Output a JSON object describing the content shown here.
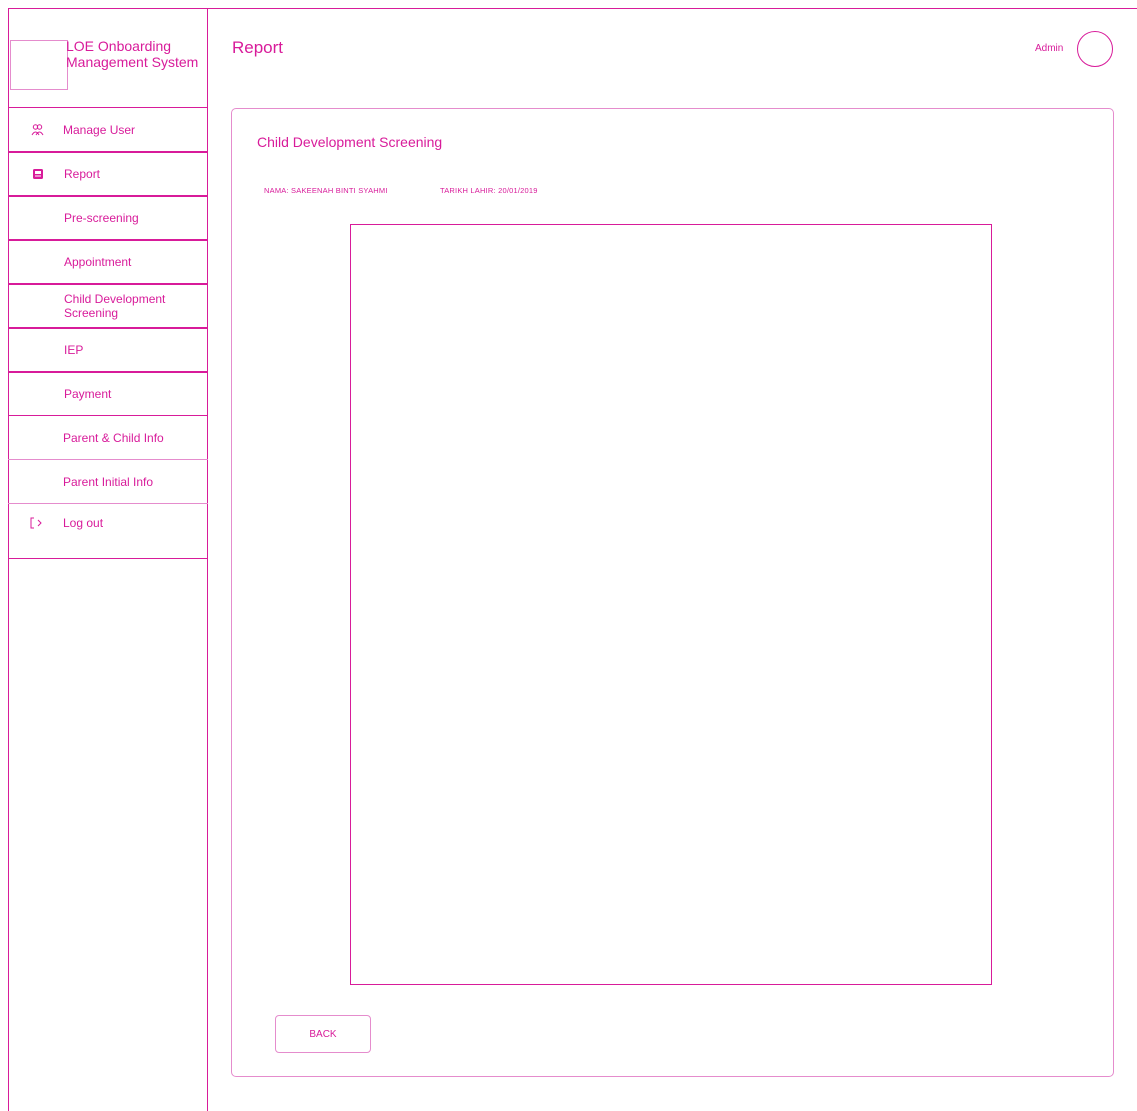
{
  "app": {
    "title": "LOE Onboarding Management System"
  },
  "header": {
    "page_title": "Report",
    "user_label": "Admin"
  },
  "sidebar": {
    "items": [
      {
        "label": "Manage User",
        "icon": "users-icon"
      },
      {
        "label": "Report",
        "icon": "report-icon"
      },
      {
        "label": "Pre-screening"
      },
      {
        "label": "Appointment"
      },
      {
        "label": "Child Development Screening"
      },
      {
        "label": "IEP"
      },
      {
        "label": "Payment"
      },
      {
        "label": "Parent & Child Info"
      },
      {
        "label": "Parent Initial Info"
      },
      {
        "label": "Log out",
        "icon": "logout-icon"
      }
    ]
  },
  "main": {
    "card_title": "Child Development Screening",
    "name_text": "NAMA: SAKEENAH BINTI SYAHMI",
    "dob_text": "TARIKH LAHIR: 20/01/2019",
    "back_label": "BACK"
  },
  "colors": {
    "accent": "#d81b9a",
    "accent_soft": "#e58ccd"
  }
}
